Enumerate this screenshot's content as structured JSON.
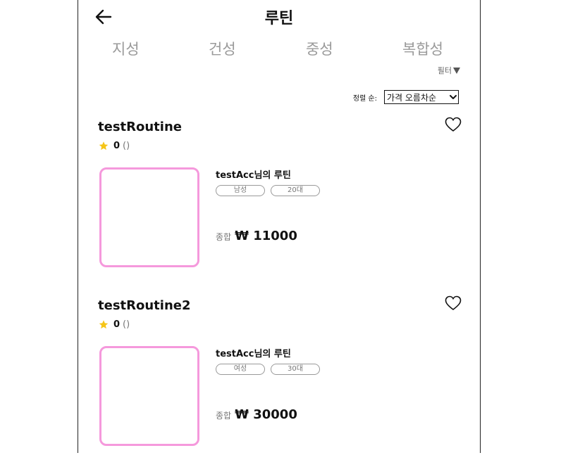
{
  "header": {
    "title": "루틴"
  },
  "tabs": [
    "지성",
    "건성",
    "중성",
    "복합성"
  ],
  "filter_label": "필터",
  "sort": {
    "label": "정렬 순:",
    "selected": "가격 오름차순"
  },
  "cards": [
    {
      "title": "testRoutine",
      "rating": "0",
      "rating_count": "()",
      "author": "testAcc님의 루틴",
      "tags": [
        "남성",
        "20대"
      ],
      "price_label": "종합",
      "price": "₩ 11000"
    },
    {
      "title": "testRoutine2",
      "rating": "0",
      "rating_count": "()",
      "author": "testAcc님의 루틴",
      "tags": [
        "여성",
        "30대"
      ],
      "price_label": "종합",
      "price": "₩ 30000"
    }
  ],
  "colors": {
    "thumb_border": "#f599dc",
    "star": "#f5c518",
    "tab_text": "#9a9a9a"
  }
}
